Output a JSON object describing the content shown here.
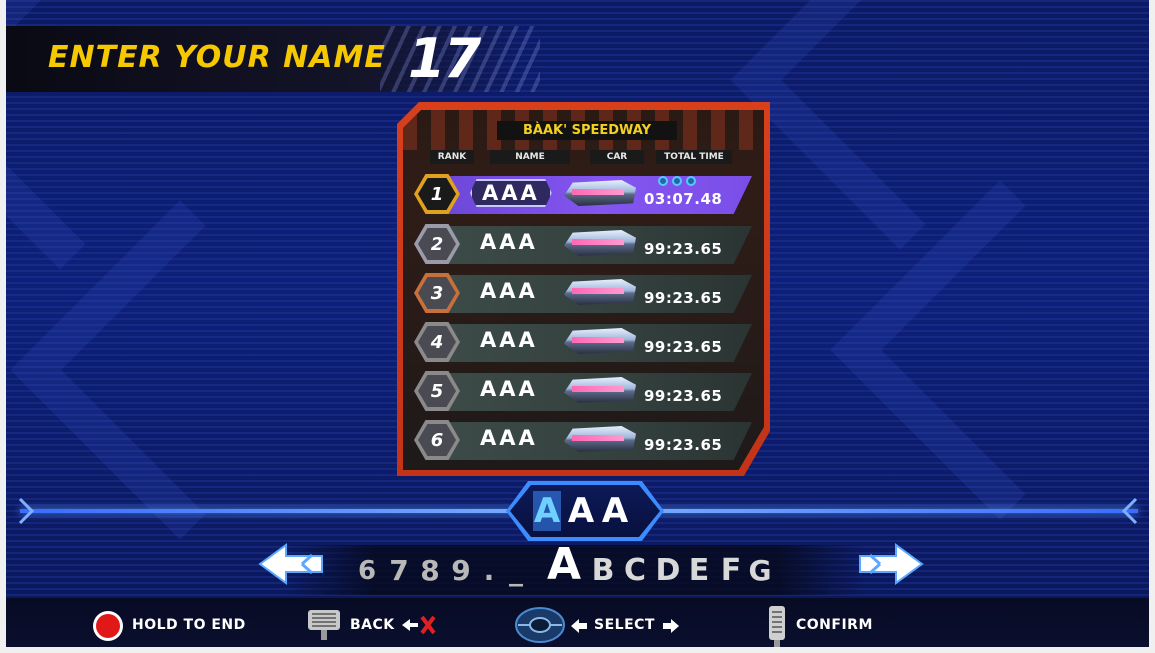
{
  "header": {
    "title": "ENTER YOUR NAME",
    "timer": "17"
  },
  "leaderboard": {
    "track_name": "BÀAK' SPEEDWAY",
    "columns": [
      "RANK",
      "NAME",
      "CAR",
      "TOTAL TIME"
    ],
    "rows": [
      {
        "rank": "1",
        "name": "AAA",
        "time": "03:07.48",
        "highlight": true
      },
      {
        "rank": "2",
        "name": "AAA",
        "time": "99:23.65",
        "highlight": false
      },
      {
        "rank": "3",
        "name": "AAA",
        "time": "99:23.65",
        "highlight": false
      },
      {
        "rank": "4",
        "name": "AAA",
        "time": "99:23.65",
        "highlight": false
      },
      {
        "rank": "5",
        "name": "AAA",
        "time": "99:23.65",
        "highlight": false
      },
      {
        "rank": "6",
        "name": "AAA",
        "time": "99:23.65",
        "highlight": false
      }
    ],
    "rank_colors": [
      "#e0a020",
      "#9a9aa8",
      "#c8703a",
      "#8a8a8a",
      "#8a8a8a",
      "#8a8a8a"
    ]
  },
  "entry": {
    "chars": [
      "A",
      "A",
      "A"
    ],
    "active_index": 0
  },
  "selector": {
    "chars": [
      "6",
      "7",
      "8",
      "9",
      ".",
      "_",
      "A",
      "B",
      "C",
      "D",
      "E",
      "F",
      "G"
    ],
    "selected": "A"
  },
  "footer": {
    "hold_to_end": "HOLD TO END",
    "back": "BACK",
    "select": "SELECT",
    "confirm": "CONFIRM"
  }
}
